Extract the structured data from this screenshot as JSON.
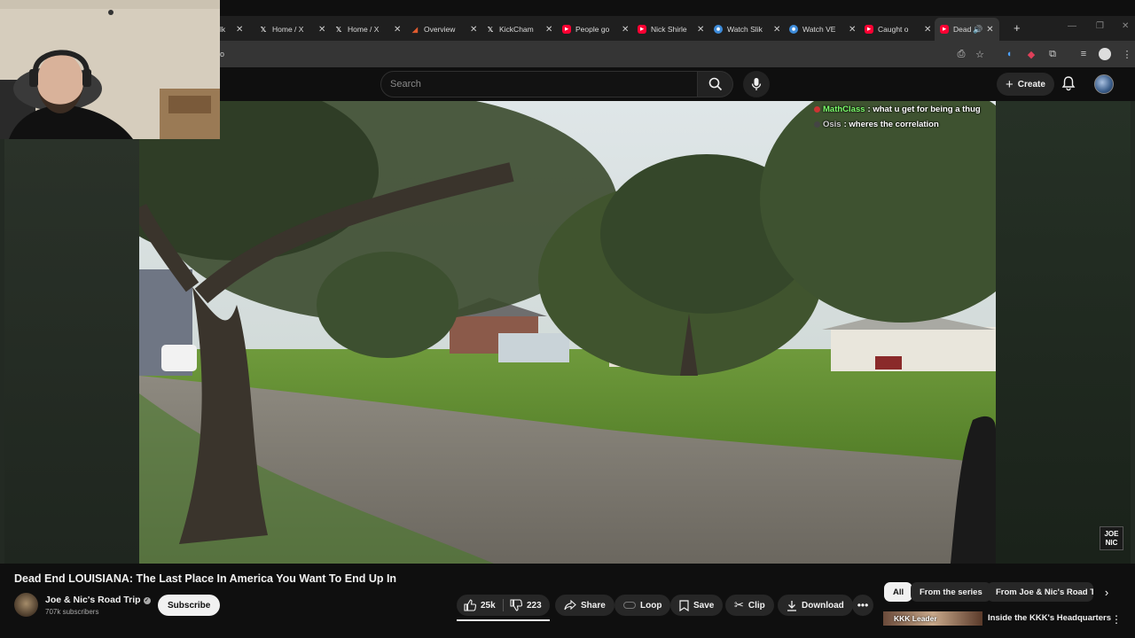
{
  "browser": {
    "tabs": [
      {
        "title": "lk",
        "favicon": "generic-icon"
      },
      {
        "title": "Home / X",
        "favicon": "x-icon"
      },
      {
        "title": "Home / X",
        "favicon": "x-icon"
      },
      {
        "title": "Overview",
        "favicon": "triangle-icon"
      },
      {
        "title": "KickCham",
        "favicon": "x-icon"
      },
      {
        "title": "People go",
        "favicon": "youtube-icon"
      },
      {
        "title": "Nick Shirle",
        "favicon": "youtube-icon"
      },
      {
        "title": "Watch Slik",
        "favicon": "stream-icon"
      },
      {
        "title": "Watch VE",
        "favicon": "stream-icon"
      },
      {
        "title": "Caught o",
        "favicon": "youtube-icon"
      },
      {
        "title": "Dead",
        "favicon": "youtube-icon"
      }
    ],
    "new_tab_label": "+",
    "address_text": "o"
  },
  "masthead": {
    "search_placeholder": "Search",
    "create_label": "Create"
  },
  "player": {
    "chat": [
      {
        "user": "MathClass",
        "message": ": what u get for being a thug"
      },
      {
        "user": "Osis",
        "message": ": wheres the correlation"
      }
    ],
    "watermark_line1": "JOE",
    "watermark_line2": "NIC"
  },
  "video": {
    "title": "Dead End LOUISIANA: The Last Place In America You Want To End Up In",
    "channel_name": "Joe & Nic's Road Trip",
    "subscribers": "707k subscribers",
    "subscribe_label": "Subscribe",
    "likes": "25k",
    "dislikes": "223",
    "share_label": "Share",
    "loop_label": "Loop",
    "save_label": "Save",
    "clip_label": "Clip",
    "download_label": "Download"
  },
  "related": {
    "chips": [
      "All",
      "From the series",
      "From Joe & Nic's Road Tr"
    ],
    "active_chip": "All",
    "first_item_thumb_text": "KKK Leader",
    "first_item_title": "Inside the KKK's Headquarters"
  },
  "colors": {
    "background": "#0f0f0f",
    "accent_red": "#ff0033",
    "chat_user_green": "#7cff6b"
  }
}
